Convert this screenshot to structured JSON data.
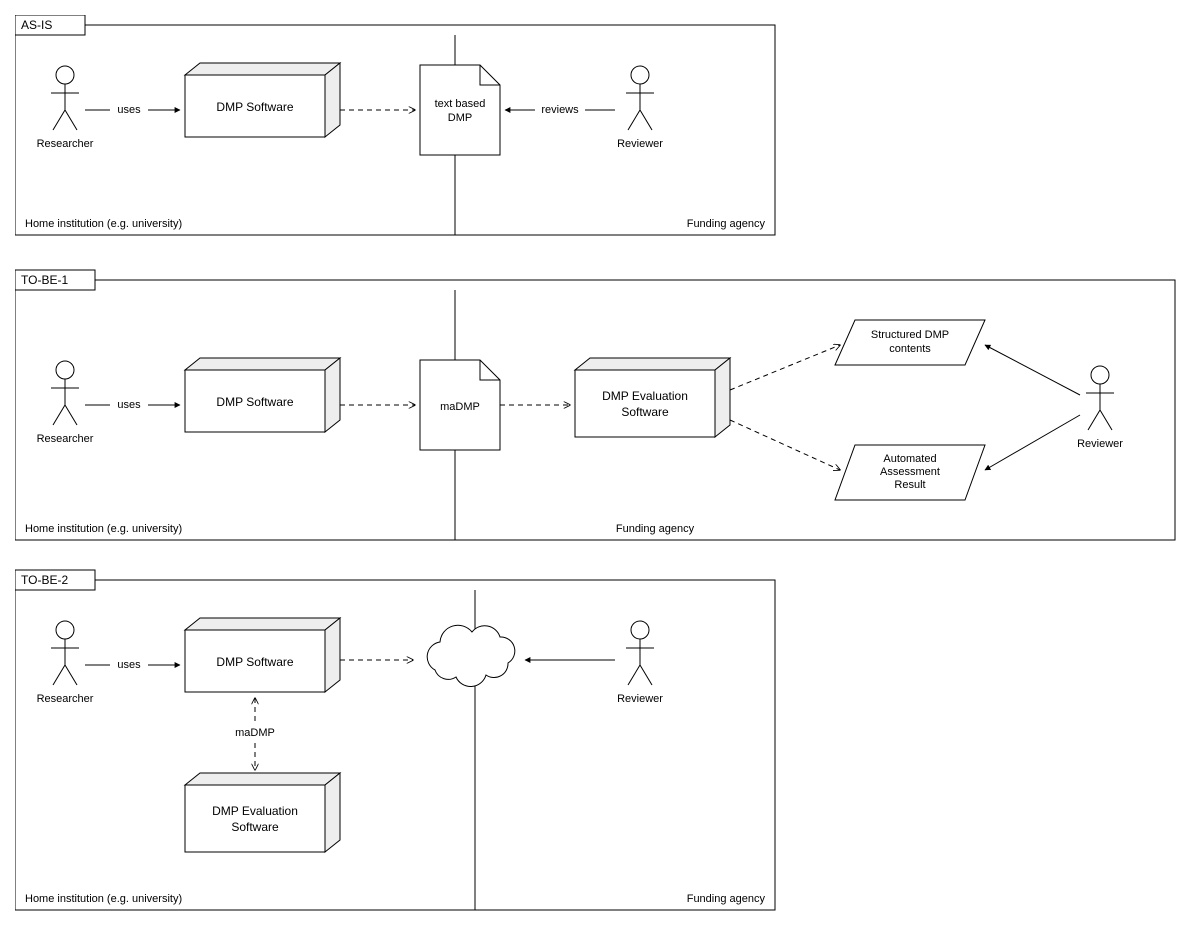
{
  "panels": {
    "asis": {
      "title": "AS-IS",
      "leftRegion": "Home institution (e.g. university)",
      "rightRegion": "Funding agency",
      "researcher": "Researcher",
      "reviewer": "Reviewer",
      "dmpSoftware": "DMP Software",
      "doc1": "text based",
      "doc2": "DMP",
      "usesLabel": "uses",
      "reviewsLabel": "reviews"
    },
    "tobe1": {
      "title": "TO-BE-1",
      "leftRegion": "Home institution (e.g. university)",
      "rightRegion": "Funding agency",
      "researcher": "Researcher",
      "reviewer": "Reviewer",
      "dmpSoftware": "DMP Software",
      "maDmp": "maDMP",
      "eval1": "DMP Evaluation",
      "eval2": "Software",
      "par1a": "Structured DMP",
      "par1b": "contents",
      "par2a": "Automated",
      "par2b": "Assessment",
      "par2c": "Result",
      "usesLabel": "uses"
    },
    "tobe2": {
      "title": "TO-BE-2",
      "leftRegion": "Home institution (e.g. university)",
      "rightRegion": "Funding agency",
      "researcher": "Researcher",
      "reviewer": "Reviewer",
      "dmpSoftware": "DMP Software",
      "eval1": "DMP Evaluation",
      "eval2": "Software",
      "maDmp": "maDMP",
      "usesLabel": "uses"
    }
  }
}
